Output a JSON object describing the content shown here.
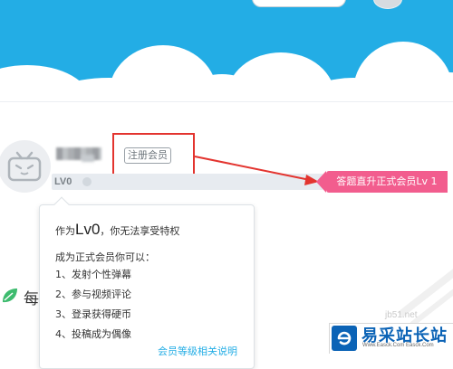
{
  "profile": {
    "register_badge": "注册会员",
    "level_tag": "LV0"
  },
  "tooltip": {
    "title_prefix": "作为",
    "title_level": "Lv0",
    "title_suffix": "，你无法享受特权",
    "subtitle": "成为正式会员你可以：",
    "items": [
      "1、发射个性弹幕",
      "2、参与视频评论",
      "3、登录获得硬币",
      "4、投稿成为偶像"
    ],
    "link": "会员等级相关说明"
  },
  "callout": {
    "text": "答题直升正式会员Lv 1"
  },
  "side": {
    "text": "每"
  },
  "watermark": {
    "title": "易采站长站",
    "subtitle": "Www.Easck.Com Easck.Com",
    "faint_text": "jb51.net"
  },
  "colors": {
    "banner": "#23ade5",
    "highlight_red": "#e3342f",
    "cta_pink": "#f25d8e",
    "watermark_blue": "#0b63b6"
  }
}
